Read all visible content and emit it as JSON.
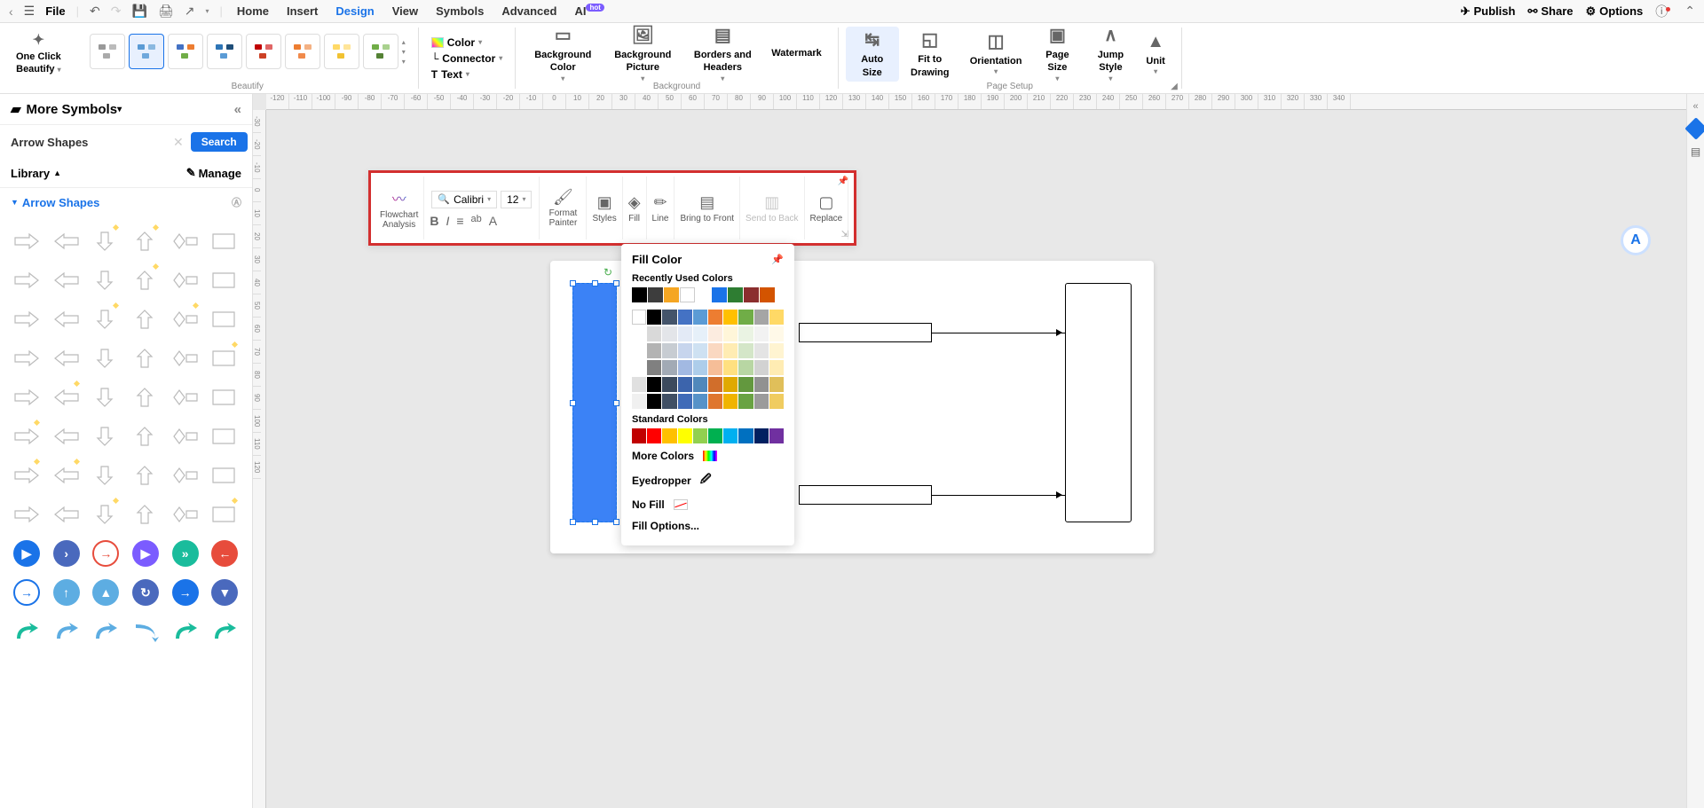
{
  "topbar": {
    "file_label": "File",
    "tabs": [
      "Home",
      "Insert",
      "Design",
      "View",
      "Symbols",
      "Advanced",
      "AI"
    ],
    "active_tab": "Design",
    "hot_label": "hot",
    "publish": "Publish",
    "share": "Share",
    "options": "Options"
  },
  "ribbon": {
    "one_click_line1": "One Click",
    "one_click_line2": "Beautify",
    "beautify_label": "Beautify",
    "color_label": "Color",
    "connector_label": "Connector",
    "text_label": "Text",
    "bg_color": "Background Color",
    "bg_picture": "Background Picture",
    "borders_headers": "Borders and Headers",
    "watermark": "Watermark",
    "background_label": "Background",
    "auto_size": "Auto Size",
    "fit_drawing": "Fit to Drawing",
    "orientation": "Orientation",
    "page_size": "Page Size",
    "jump_style": "Jump Style",
    "unit": "Unit",
    "page_setup_label": "Page Setup"
  },
  "leftpanel": {
    "more_symbols": "More Symbols",
    "search_value": "Arrow Shapes",
    "search_btn": "Search",
    "library": "Library",
    "manage": "Manage",
    "section_title": "Arrow Shapes"
  },
  "float_toolbar": {
    "flowchart_line1": "Flowchart",
    "flowchart_line2": "Analysis",
    "font_name": "Calibri",
    "font_size": "12",
    "format_painter": "Format Painter",
    "styles": "Styles",
    "fill": "Fill",
    "line": "Line",
    "bring_front": "Bring to Front",
    "send_back": "Send to Back",
    "replace": "Replace"
  },
  "fill_popup": {
    "title": "Fill Color",
    "recent_label": "Recently Used Colors",
    "recent": [
      "#000000",
      "#3d3d3d",
      "#f5a623",
      "#ffffff",
      "",
      "#1a73e8",
      "#2e7d32",
      "#8b2e2e",
      "#d35400"
    ],
    "palette_header": [
      "#ffffff",
      "#000000",
      "#44546a",
      "#4472c4",
      "#5b9bd5",
      "#ed7d31",
      "#ffc000",
      "#70ad47",
      "#a5a5a5",
      "#ffd966"
    ],
    "standard_label": "Standard Colors",
    "standard": [
      "#c00000",
      "#ff0000",
      "#ffc000",
      "#ffff00",
      "#92d050",
      "#00b050",
      "#00b0f0",
      "#0070c0",
      "#002060",
      "#7030a0"
    ],
    "more_colors": "More Colors",
    "eyedropper": "Eyedropper",
    "no_fill": "No Fill",
    "fill_options": "Fill Options..."
  },
  "ruler_h": [
    "-120",
    "-110",
    "-100",
    "-90",
    "-80",
    "-70",
    "-60",
    "-50",
    "-40",
    "-30",
    "-20",
    "-10",
    "0",
    "10",
    "20",
    "30",
    "40",
    "50",
    "60",
    "70",
    "80",
    "90",
    "100",
    "110",
    "120",
    "130",
    "140",
    "150",
    "160",
    "170",
    "180",
    "190",
    "200",
    "210",
    "220",
    "230",
    "240",
    "250",
    "260",
    "270",
    "280",
    "290",
    "300",
    "310",
    "320",
    "330",
    "340"
  ],
  "ruler_v": [
    "-30",
    "-20",
    "-10",
    "0",
    "10",
    "20",
    "30",
    "40",
    "50",
    "60",
    "70",
    "80",
    "90",
    "100",
    "110",
    "120"
  ]
}
